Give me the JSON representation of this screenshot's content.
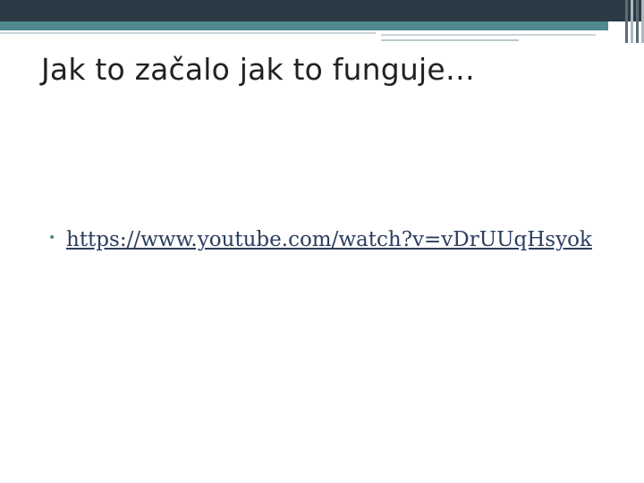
{
  "slide": {
    "title": "Jak to začalo jak to funguje…",
    "bullets": [
      {
        "link_text": "https://www.youtube.com/watch?v=vDrUUqHsyok"
      }
    ]
  },
  "colors": {
    "header_dark": "#2b3a44",
    "accent": "#4f8a8f",
    "link": "#2c3e60"
  }
}
